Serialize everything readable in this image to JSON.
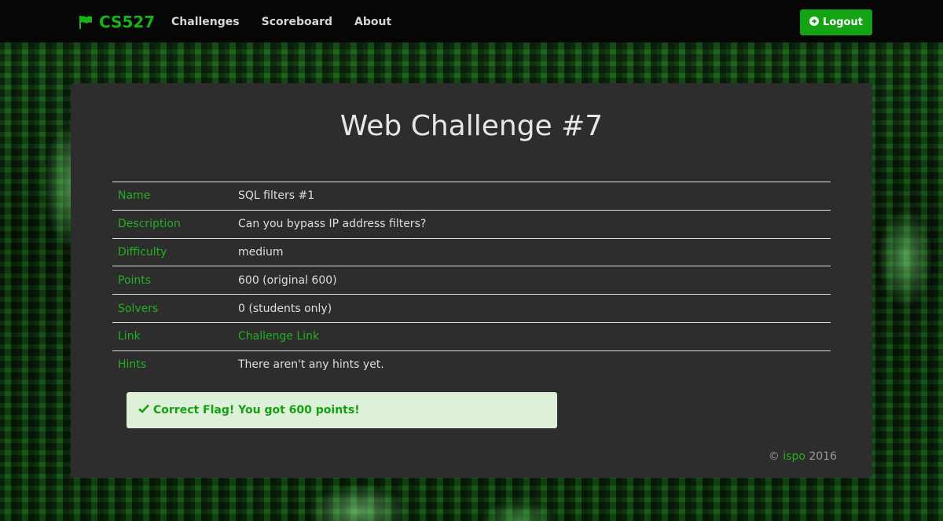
{
  "navbar": {
    "brand": "CS527",
    "links": [
      "Challenges",
      "Scoreboard",
      "About"
    ],
    "logout_label": "Logout"
  },
  "challenge": {
    "title": "Web Challenge #7",
    "rows": [
      {
        "label": "Name",
        "value": "SQL filters #1"
      },
      {
        "label": "Description",
        "value": "Can you bypass IP address filters?"
      },
      {
        "label": "Difficulty",
        "value": "medium"
      },
      {
        "label": "Points",
        "value": "600 (original 600)"
      },
      {
        "label": "Solvers",
        "value": "0 (students only)"
      },
      {
        "label": "Link",
        "value": "Challenge Link"
      },
      {
        "label": "Hints",
        "value": "There aren't any hints yet."
      }
    ]
  },
  "alert": {
    "message": "Correct Flag! You got 600 points!",
    "icon": "check-icon"
  },
  "footer": {
    "copyright_symbol": "©",
    "author": "ispo",
    "year": "2016"
  },
  "colors": {
    "accent": "#16b216",
    "navbar_bg": "#060606",
    "panel_bg": "#2d2d2d",
    "alert_bg": "#dff0d8"
  }
}
